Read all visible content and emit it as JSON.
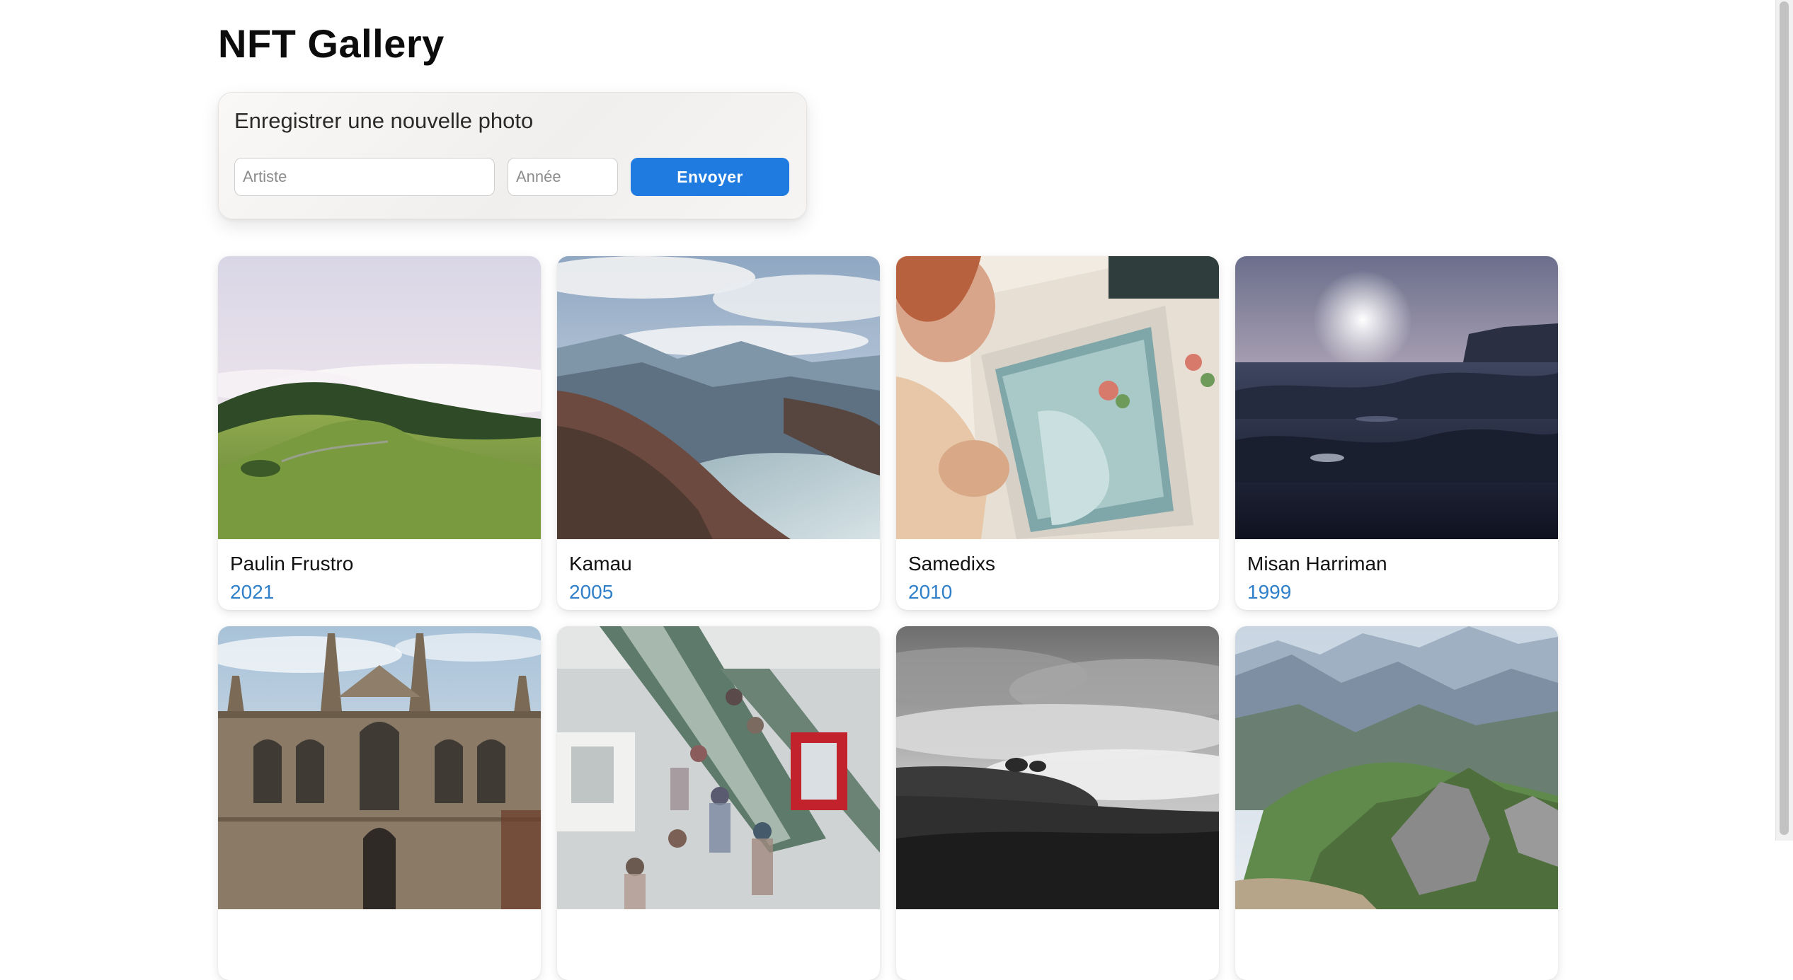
{
  "page": {
    "title": "NFT Gallery"
  },
  "form": {
    "title": "Enregistrer une nouvelle photo",
    "artist_placeholder": "Artiste",
    "artist_value": "",
    "year_placeholder": "Année",
    "year_value": "",
    "submit_label": "Envoyer",
    "accent_color": "#1f7be0"
  },
  "gallery": {
    "year_color": "#2f80c8",
    "cards": [
      {
        "artist": "Paulin Frustro",
        "year": "2021",
        "image": "green-hills-and-fog-photo"
      },
      {
        "artist": "Kamau",
        "year": "2005",
        "image": "mountain-lake-valley-photo"
      },
      {
        "artist": "Samedixs",
        "year": "2010",
        "image": "couple-in-vintage-van-photo"
      },
      {
        "artist": "Misan Harriman",
        "year": "1999",
        "image": "dark-sea-waves-photo"
      },
      {
        "image": "gothic-college-building-photo"
      },
      {
        "image": "crowded-station-escalators-photo"
      },
      {
        "image": "black-and-white-sea-of-clouds-photo"
      },
      {
        "image": "mountain-ridge-landscape-photo"
      }
    ]
  }
}
